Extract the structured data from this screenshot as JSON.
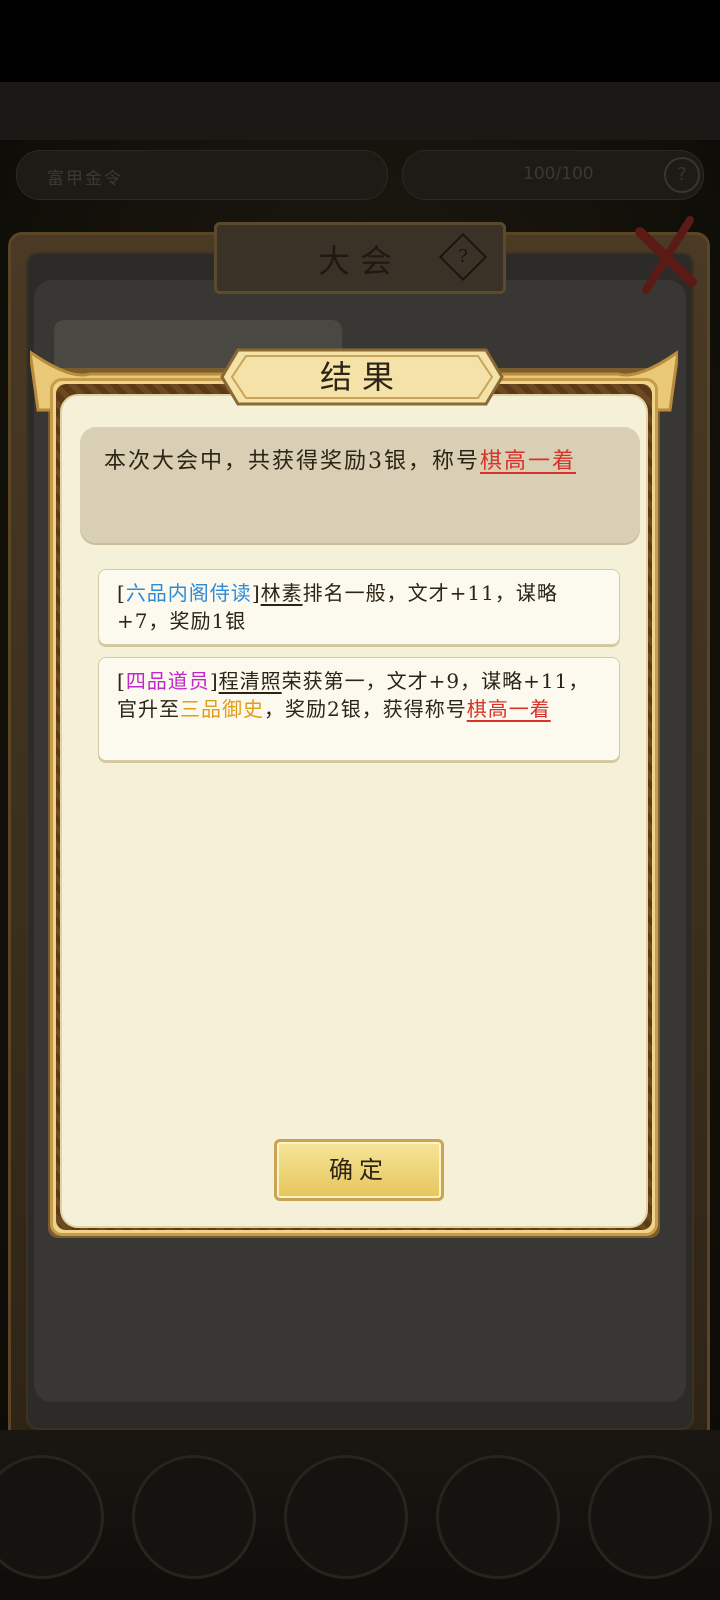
{
  "background": {
    "panel_title": "大会",
    "info_left": "富甲金令",
    "info_right": "100/100"
  },
  "modal": {
    "title": "结果",
    "summary_text": "本次大会中，共获得奖励3银，称号",
    "summary_honor": "棋高一着",
    "entries": [
      {
        "open": "[",
        "rank": "六品内阁侍读",
        "close": "]",
        "name": "林素",
        "text": "排名一般，文才+11，谋略+7，奖励1银"
      },
      {
        "open": "[",
        "rank": "四品道员",
        "close": "]",
        "name": "程清照",
        "text_before": "荣获第一，文才+9，谋略+11，官升至",
        "promotion": "三品御史",
        "text_after": "，奖励2银，获得称号",
        "honor": "棋高一着"
      }
    ],
    "confirm_label": "确定"
  },
  "colors": {
    "honor_red": "#d8322a",
    "rank_blue": "#2f8bd6",
    "rank_purple": "#c227c9",
    "promotion_gold": "#e39b1a",
    "parchment": "#f5f0d8"
  },
  "icons": [
    "help-icon",
    "close-x-icon"
  ]
}
